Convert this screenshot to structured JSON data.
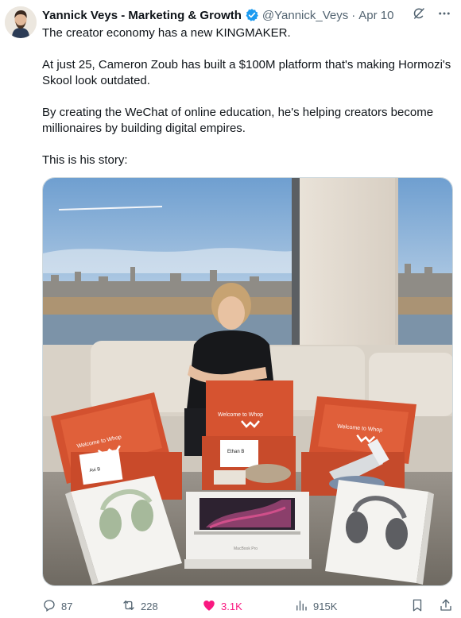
{
  "author": {
    "name": "Yannick Veys - Marketing & Growth",
    "handle": "@Yannick_Veys",
    "separator": "·",
    "date": "Apr 10"
  },
  "tweet": {
    "paragraphs": [
      "The creator economy has a new KINGMAKER.",
      "At just 25, Cameron Zoub has built a $100M platform that's making Hormozi's Skool look outdated.",
      "By creating the WeChat of online education, he's helping creators become millionaires by building digital empires.",
      "This is his story:"
    ]
  },
  "media": {
    "box_text": "Welcome to Whop",
    "left_card": "Avi B",
    "center_card": "Ethan B",
    "laptop_label": "MacBook Pro"
  },
  "actions": {
    "replies": "87",
    "reposts": "228",
    "likes": "3.1K",
    "views": "915K"
  },
  "colors": {
    "text": "#0f1419",
    "secondary": "#536471",
    "like": "#f91880",
    "verified": "#1d9bf0"
  },
  "icons": [
    "verified-badge-icon",
    "grok-icon",
    "more-icon",
    "reply-icon",
    "repost-icon",
    "like-icon",
    "views-icon",
    "bookmark-icon",
    "share-icon"
  ]
}
